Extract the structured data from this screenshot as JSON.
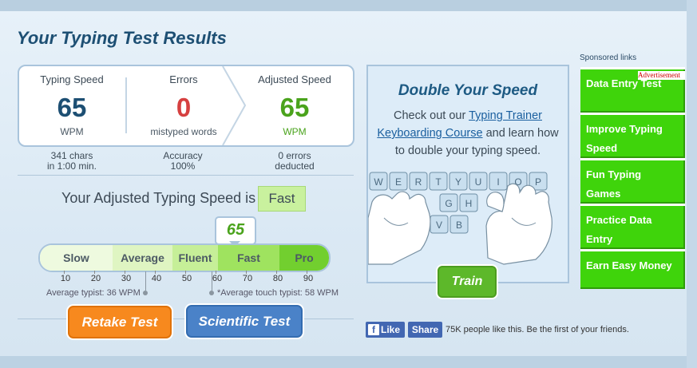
{
  "page": {
    "title": "Your Typing Test Results"
  },
  "stats": {
    "typing_speed": {
      "label": "Typing Speed",
      "value": "65",
      "unit": "WPM",
      "sub1": "341 chars",
      "sub2": "in 1:00 min."
    },
    "errors": {
      "label": "Errors",
      "value": "0",
      "unit": "mistyped words",
      "sub1": "Accuracy",
      "sub2": "100%"
    },
    "adjusted": {
      "label": "Adjusted Speed",
      "value": "65",
      "unit": "WPM",
      "sub1": "0 errors",
      "sub2": "deducted"
    }
  },
  "adjusted_line": {
    "text": "Your Adjusted Typing Speed is",
    "badge": "Fast"
  },
  "scale": {
    "pointer_value": "65",
    "segments": [
      "Slow",
      "Average",
      "Fluent",
      "Fast",
      "Pro"
    ],
    "ticks": [
      "10",
      "20",
      "30",
      "40",
      "50",
      "60",
      "70",
      "80",
      "90"
    ],
    "average_typist": "Average typist: 36 WPM",
    "average_touch_typist": "*Average touch typist: 58 WPM"
  },
  "buttons": {
    "retake": "Retake Test",
    "scientific": "Scientific Test",
    "train": "Train"
  },
  "promo": {
    "title": "Double Your Speed",
    "text_before": "Check out our",
    "link": "Typing Trainer Keyboarding Course",
    "text_after": "and learn how to double your typing speed.",
    "keys_row1": [
      "W",
      "E",
      "R",
      "T",
      "Y",
      "U",
      "I",
      "O",
      "P"
    ],
    "keys_row2": [
      "G",
      "H"
    ],
    "keys_row3": [
      "V",
      "B"
    ]
  },
  "facebook": {
    "like": "Like",
    "share": "Share",
    "text": "75K people like this. Be the first of your friends."
  },
  "sponsored": {
    "label": "Sponsored links",
    "ad_tag": "Advertisement",
    "items": [
      "Data Entry Test",
      "Improve Typing Speed",
      "Fun Typing Games",
      "Practice Data Entry",
      "Earn Easy Money"
    ]
  },
  "colors": {
    "speed": "#1d4f73",
    "errors": "#d64040",
    "adjusted": "#4aa31c",
    "ad_green": "#3fd40b"
  }
}
